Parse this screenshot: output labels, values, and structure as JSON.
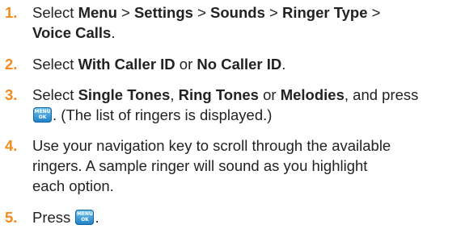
{
  "steps": [
    {
      "number": "1.",
      "lines": [
        {
          "t1": "Select ",
          "b1": "Menu",
          "t2": " > ",
          "b2": "Settings",
          "t3": " > ",
          "b3": "Sounds",
          "t4": " > ",
          "b4": "Ringer Type",
          "t5": " >"
        },
        {
          "b1": "Voice Calls",
          "t1": "."
        }
      ]
    },
    {
      "number": "2.",
      "lines": [
        {
          "t1": "Select ",
          "b1": "With Caller ID",
          "t2": " or ",
          "b2": "No Caller ID",
          "t3": "."
        }
      ]
    },
    {
      "number": "3.",
      "lines": [
        {
          "t1": "Select ",
          "b1": "Single Tones",
          "t2": ", ",
          "b2": "Ring Tones",
          "t3": " or ",
          "b3": "Melodies",
          "t4": ", and press"
        },
        {
          "t1": ". (The list of ringers is displayed.)"
        }
      ]
    },
    {
      "number": "4.",
      "lines": [
        "Use your navigation key to scroll through the available",
        "ringers. A sample ringer will sound as you highlight",
        "each option."
      ]
    },
    {
      "number": "5.",
      "lines": [
        {
          "t1": "Press ",
          "t2": "."
        }
      ]
    }
  ],
  "menu_ok_key": {
    "top": "MENU",
    "bottom": "OK",
    "icon": "menu-ok-key-icon"
  },
  "colors": {
    "step_number": "#f28c1e",
    "key_blue": "#1f7fc6",
    "text": "#222222"
  }
}
